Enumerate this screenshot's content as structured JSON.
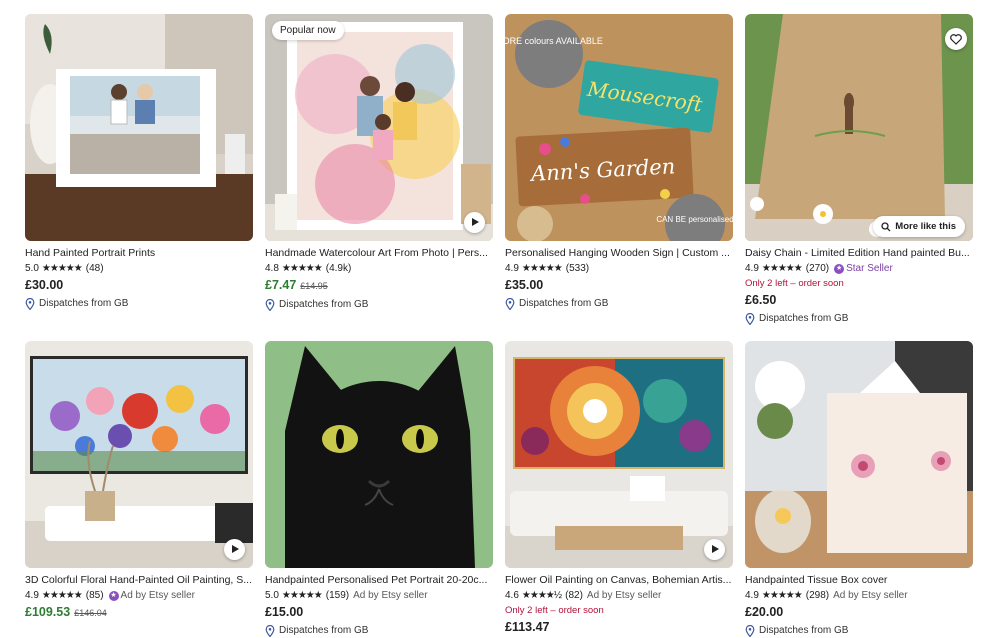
{
  "colors": {
    "sale_price": "#2e7d32",
    "urgency": "#b3123a",
    "star_seller": "#7b3fa3"
  },
  "listings": [
    {
      "title": "Hand Painted Portrait Prints",
      "rating": "5.0",
      "stars": "★★★★★",
      "reviews": "(48)",
      "price": "£30.00",
      "shipping": "Dispatches from GB",
      "image_icon": "portrait-print-image"
    },
    {
      "badge": "Popular now",
      "title": "Handmade Watercolour Art From Photo | Pers...",
      "rating": "4.8",
      "stars": "★★★★★",
      "reviews": "(4.9k)",
      "price": "£7.47",
      "original_price": "£14.95",
      "shipping": "Dispatches from GB",
      "image_icon": "watercolour-family-image"
    },
    {
      "title": "Personalised Hanging Wooden Sign | Custom ...",
      "rating": "4.9",
      "stars": "★★★★★",
      "reviews": "(533)",
      "price": "£35.00",
      "shipping": "Dispatches from GB",
      "image_top_badge": "MORE colours AVAILABLE",
      "image_sign_1": "Mousecroft",
      "image_sign_2": "Ann's Garden",
      "image_bottom_badge": "CAN BE personalised"
    },
    {
      "title": "Daisy Chain - Limited Edition Hand painted Bu...",
      "rating": "4.9",
      "stars": "★★★★★",
      "reviews": "(270)",
      "seller_badge": "Star Seller",
      "urgency": "Only 2 left – order soon",
      "price": "£6.50",
      "shipping": "Dispatches from GB",
      "more_like_this": "More like this"
    },
    {
      "title": "3D Colorful Floral Hand-Painted Oil Painting, S...",
      "rating": "4.9",
      "stars": "★★★★★",
      "reviews": "(85)",
      "seller_badge": "Ad by Etsy seller",
      "price": "£109.53",
      "original_price": "£146.04"
    },
    {
      "title": "Handpainted Personalised Pet Portrait 20-20c...",
      "rating": "5.0",
      "stars": "★★★★★",
      "reviews": "(159)",
      "seller_badge": "Ad by Etsy seller",
      "price": "£15.00",
      "shipping": "Dispatches from GB"
    },
    {
      "title": "Flower Oil Painting on Canvas, Bohemian Artis...",
      "rating": "4.6",
      "stars": "★★★★½",
      "reviews": "(82)",
      "seller_badge": "Ad by Etsy seller",
      "urgency": "Only 2 left – order soon",
      "price": "£113.47"
    },
    {
      "title": "Handpainted Tissue Box cover",
      "rating": "4.9",
      "stars": "★★★★★",
      "reviews": "(298)",
      "seller_badge": "Ad by Etsy seller",
      "price": "£20.00",
      "shipping": "Dispatches from GB"
    }
  ]
}
